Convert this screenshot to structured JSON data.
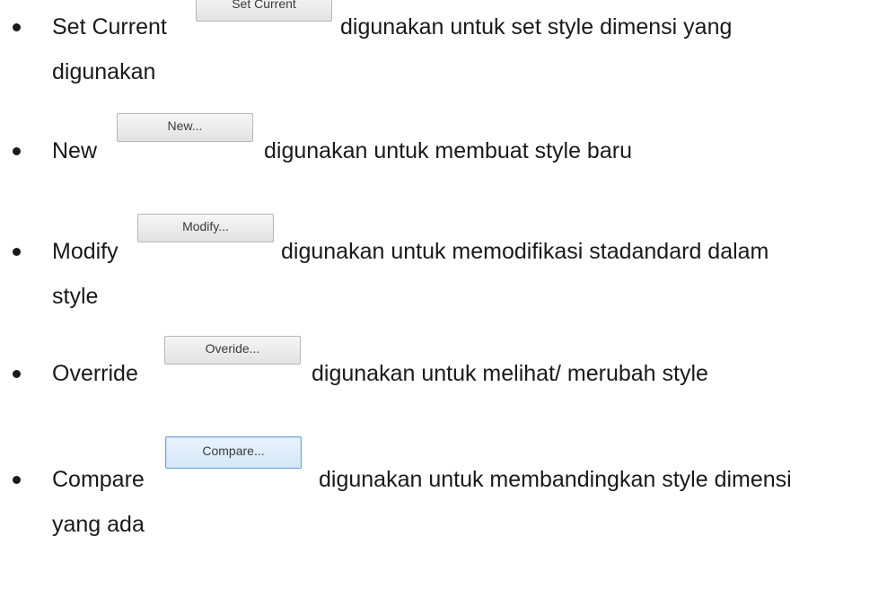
{
  "items": [
    {
      "label": "Set Current",
      "button_label": "Set Current",
      "desc_line1": "digunakan untuk set style dimensi yang",
      "desc_line2": "digunakan"
    },
    {
      "label": "New",
      "button_label": "New...",
      "desc_line1": "digunakan untuk membuat style baru"
    },
    {
      "label": "Modify",
      "button_label": "Modify...",
      "desc_line1": "digunakan untuk memodifikasi stadandard dalam",
      "desc_line2": "style"
    },
    {
      "label": "Override",
      "button_label": "Overide...",
      "desc_line1": "digunakan untuk melihat/ merubah style"
    },
    {
      "label": "Compare",
      "button_label": "Compare...",
      "desc_line1": "digunakan untuk membandingkan style dimensi",
      "desc_line2": "yang ada"
    }
  ]
}
